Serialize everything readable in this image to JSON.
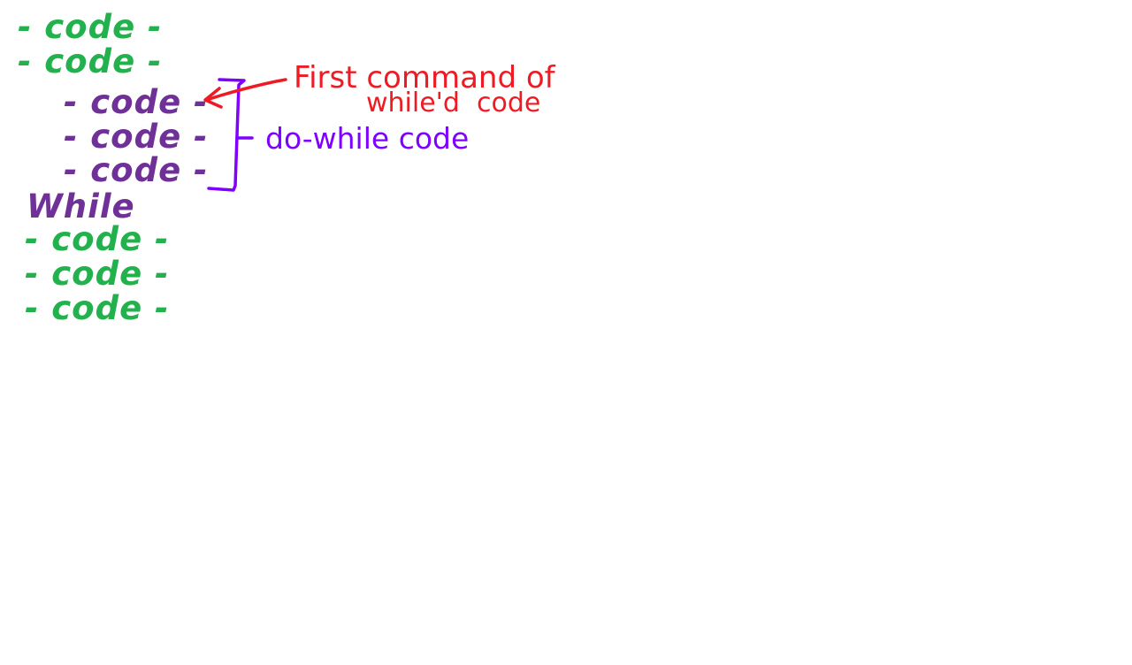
{
  "colors": {
    "background": "#ffffff",
    "outer_code": "#22b14c",
    "loop_code": "#6f3198",
    "annotation_red": "#ed1c24",
    "annotation_violet": "#8000ff"
  },
  "code_before": [
    "- code -",
    "- code -"
  ],
  "loop_body": [
    "- code -",
    "- code -",
    "- code -"
  ],
  "while_keyword": "While",
  "code_after": [
    "- code -",
    "- code -",
    "- code -"
  ],
  "annotations": {
    "first_command_line1": "First command of",
    "first_command_line2": "while'd  code",
    "do_while_label": "do-while code"
  }
}
